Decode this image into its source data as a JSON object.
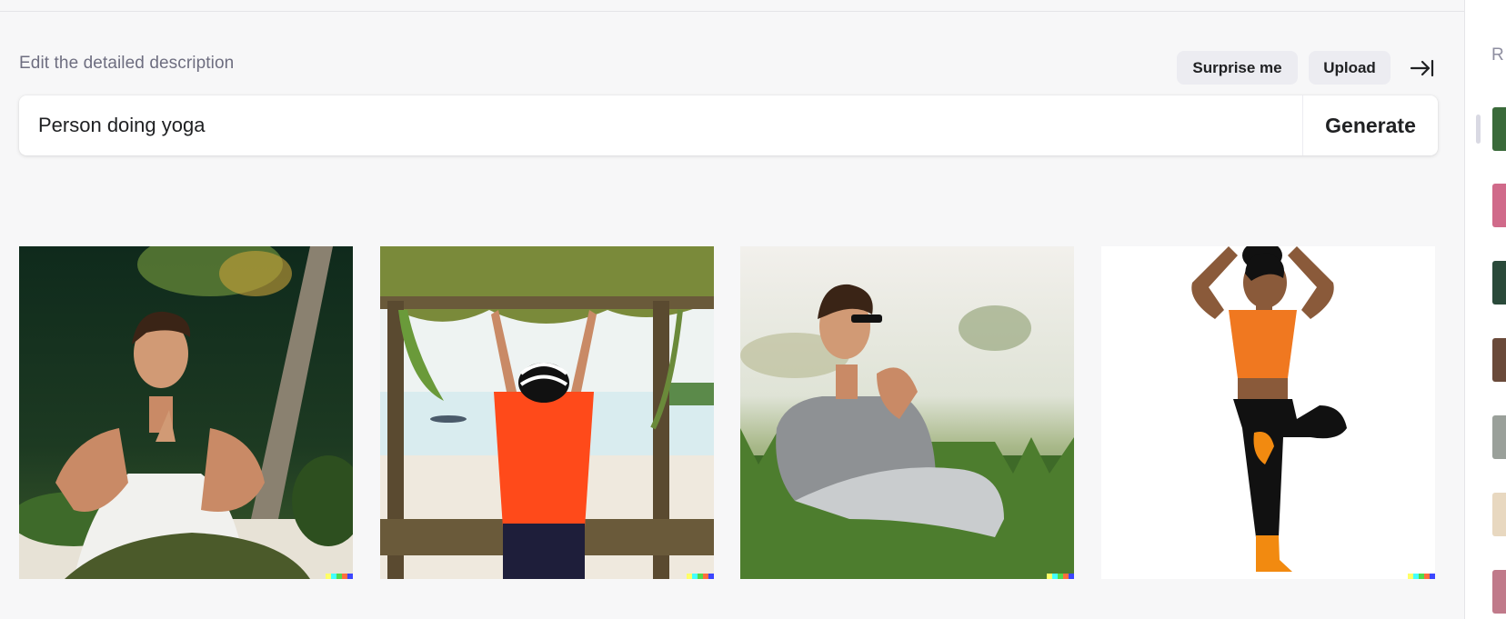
{
  "header": {
    "instruction": "Edit the detailed description",
    "surprise_label": "Surprise me",
    "upload_label": "Upload",
    "collapse_icon": "collapse-right-icon"
  },
  "prompt": {
    "value": "Person doing yoga",
    "generate_label": "Generate"
  },
  "results": [
    {
      "description": "young man in white tank top meditating with palms together near a tree"
    },
    {
      "description": "person in orange shirt and striped hat raising arms under a wooden gazebo by the water"
    },
    {
      "description": "young man in sunglasses sitting in grass with hands clasped"
    },
    {
      "description": "illustrated woman in orange top doing tree pose"
    }
  ],
  "history_panel": {
    "label": "R"
  },
  "colors": {
    "accent": "#202123",
    "muted": "#6e6e80",
    "button_bg": "#ececf1",
    "watermark": [
      "#ffff66",
      "#42ffff",
      "#51da4c",
      "#ff6e3c",
      "#3c46ff"
    ]
  }
}
